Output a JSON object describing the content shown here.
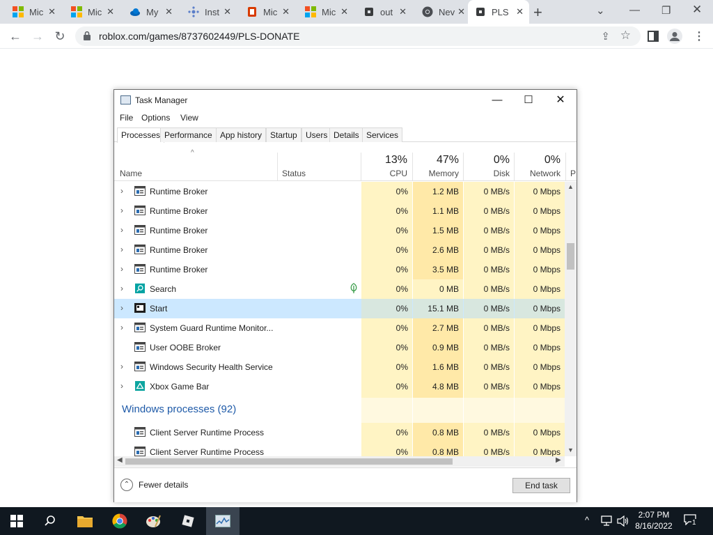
{
  "browser": {
    "tabs": [
      {
        "label": "Mic",
        "icon": "microsoft-icon"
      },
      {
        "label": "Mic",
        "icon": "microsoft-icon"
      },
      {
        "label": "My",
        "icon": "onedrive-icon"
      },
      {
        "label": "Inst",
        "icon": "cluster-icon"
      },
      {
        "label": "Mic",
        "icon": "office-icon"
      },
      {
        "label": "Mic",
        "icon": "microsoft-icon"
      },
      {
        "label": "out",
        "icon": "roblox-icon"
      },
      {
        "label": "Nev",
        "icon": "chrome-icon"
      },
      {
        "label": "PLS",
        "icon": "roblox-icon",
        "active": true
      }
    ],
    "url": "roblox.com/games/8737602449/PLS-DONATE"
  },
  "taskmanager": {
    "title": "Task Manager",
    "menu": [
      "File",
      "Options",
      "View"
    ],
    "tabs": [
      "Processes",
      "Performance",
      "App history",
      "Startup",
      "Users",
      "Details",
      "Services"
    ],
    "columns": {
      "name": "Name",
      "status": "Status",
      "cpu_pct": "13%",
      "cpu": "CPU",
      "mem_pct": "47%",
      "mem": "Memory",
      "disk_pct": "0%",
      "disk": "Disk",
      "net_pct": "0%",
      "net": "Network",
      "power": "P"
    },
    "rows": [
      {
        "name": "Runtime Broker",
        "cpu": "0%",
        "mem": "1.2 MB",
        "disk": "0 MB/s",
        "net": "0 Mbps"
      },
      {
        "name": "Runtime Broker",
        "cpu": "0%",
        "mem": "1.1 MB",
        "disk": "0 MB/s",
        "net": "0 Mbps"
      },
      {
        "name": "Runtime Broker",
        "cpu": "0%",
        "mem": "1.5 MB",
        "disk": "0 MB/s",
        "net": "0 Mbps"
      },
      {
        "name": "Runtime Broker",
        "cpu": "0%",
        "mem": "2.6 MB",
        "disk": "0 MB/s",
        "net": "0 Mbps"
      },
      {
        "name": "Runtime Broker",
        "cpu": "0%",
        "mem": "3.5 MB",
        "disk": "0 MB/s",
        "net": "0 Mbps"
      },
      {
        "name": "Search",
        "cpu": "0%",
        "mem": "0 MB",
        "disk": "0 MB/s",
        "net": "0 Mbps"
      },
      {
        "name": "Start",
        "cpu": "0%",
        "mem": "15.1 MB",
        "disk": "0 MB/s",
        "net": "0 Mbps"
      },
      {
        "name": "System Guard Runtime Monitor...",
        "cpu": "0%",
        "mem": "2.7 MB",
        "disk": "0 MB/s",
        "net": "0 Mbps"
      },
      {
        "name": "User OOBE Broker",
        "cpu": "0%",
        "mem": "0.9 MB",
        "disk": "0 MB/s",
        "net": "0 Mbps"
      },
      {
        "name": "Windows Security Health Service",
        "cpu": "0%",
        "mem": "1.6 MB",
        "disk": "0 MB/s",
        "net": "0 Mbps"
      },
      {
        "name": "Xbox Game Bar",
        "cpu": "0%",
        "mem": "4.8 MB",
        "disk": "0 MB/s",
        "net": "0 Mbps"
      }
    ],
    "group_label": "Windows processes (92)",
    "rows2": [
      {
        "name": "Client Server Runtime Process",
        "cpu": "0%",
        "mem": "0.8 MB",
        "disk": "0 MB/s",
        "net": "0 Mbps"
      },
      {
        "name": "Client Server Runtime Process",
        "cpu": "0%",
        "mem": "0.8 MB",
        "disk": "0 MB/s",
        "net": "0 Mbps"
      }
    ],
    "fewer_details": "Fewer details",
    "end_task": "End task"
  },
  "taskbar": {
    "time": "2:07 PM",
    "date": "8/16/2022",
    "notification_count": "1"
  }
}
